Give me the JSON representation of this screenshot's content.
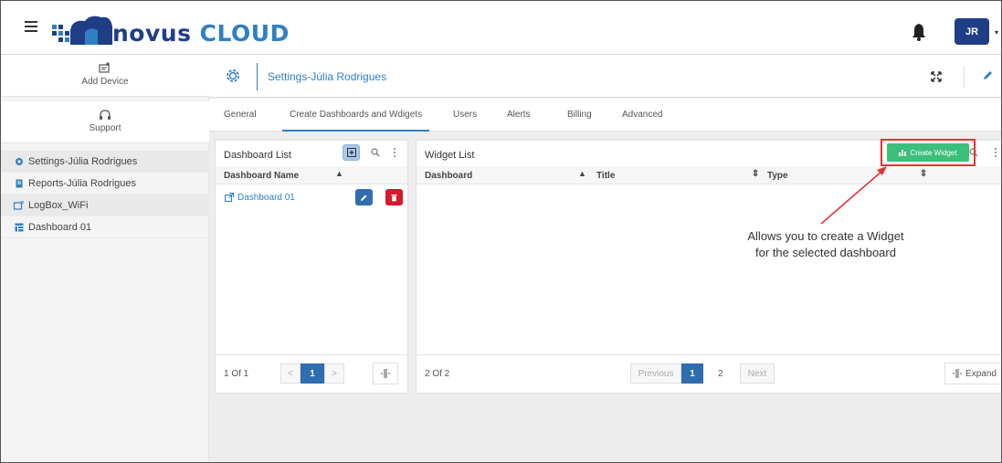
{
  "topbar": {
    "logo_text_a": "novus",
    "logo_text_b": "CLOUD",
    "avatar_initials": "JR"
  },
  "sidebar": {
    "add_device_label": "Add Device",
    "support_label": "Support",
    "items": [
      {
        "label": "Settings-Júlia Rodrigues",
        "icon": "settings-icon"
      },
      {
        "label": "Reports-Júlia Rodrigues",
        "icon": "reports-icon"
      },
      {
        "label": "LogBox_WiFi",
        "icon": "device-icon"
      },
      {
        "label": "Dashboard 01",
        "icon": "dashboard-icon"
      }
    ]
  },
  "header": {
    "title": "Settings-Júlia Rodrigues"
  },
  "tabs": [
    {
      "label": "General"
    },
    {
      "label": "Create Dashboards and Wdigets"
    },
    {
      "label": "Users"
    },
    {
      "label": "Alerts"
    },
    {
      "label": "Billing"
    },
    {
      "label": "Advanced"
    }
  ],
  "dashboard_list": {
    "title": "Dashboard List",
    "col_name": "Dashboard Name",
    "rows": [
      {
        "name": "Dashboard 01"
      }
    ],
    "page_info": "1 Of 1",
    "page_prev": "<",
    "page_current": "1",
    "page_next": ">"
  },
  "widget_list": {
    "title": "Widget List",
    "create_label": "Create Widget",
    "col_dashboard": "Dashboard",
    "col_title": "Title",
    "col_type": "Type",
    "page_info": "2 Of 2",
    "previous_label": "Previous",
    "page_current": "1",
    "page_2": "2",
    "next_label": "Next",
    "expand_label": "Expand"
  },
  "annotation": {
    "line1": "Allows you to create a Widget",
    "line2": "for the selected dashboard"
  },
  "colors": {
    "brand_blue": "#1f3e86",
    "accent_blue": "#2f7fc5",
    "create_green": "#3bbf7a",
    "delete_red": "#d9192b",
    "highlight_red": "#e23333"
  }
}
